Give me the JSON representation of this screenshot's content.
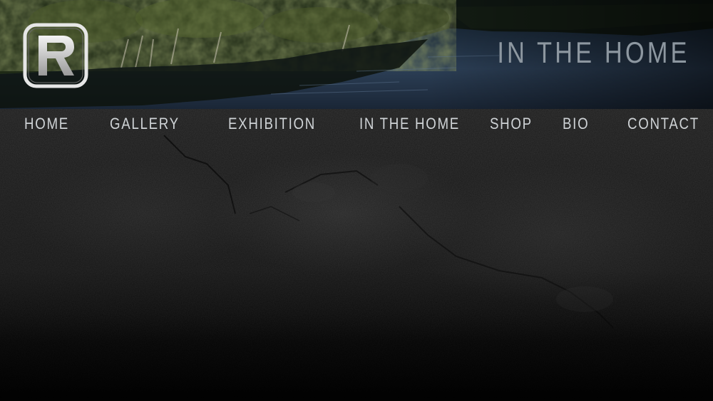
{
  "header": {
    "logo_letter": "R",
    "site_title": "IN THE HOME"
  },
  "nav": {
    "items": [
      {
        "label": "HOME"
      },
      {
        "label": "GALLERY"
      },
      {
        "label": "EXHIBITION"
      },
      {
        "label": "IN THE HOME"
      },
      {
        "label": "SHOP"
      },
      {
        "label": "BIO"
      },
      {
        "label": "CONTACT"
      }
    ]
  },
  "colors": {
    "background": "#1c1c1c",
    "nav_text": "#cfd3d6",
    "title_text": "#8d97a0",
    "logo_border": "#e6e6e6"
  }
}
